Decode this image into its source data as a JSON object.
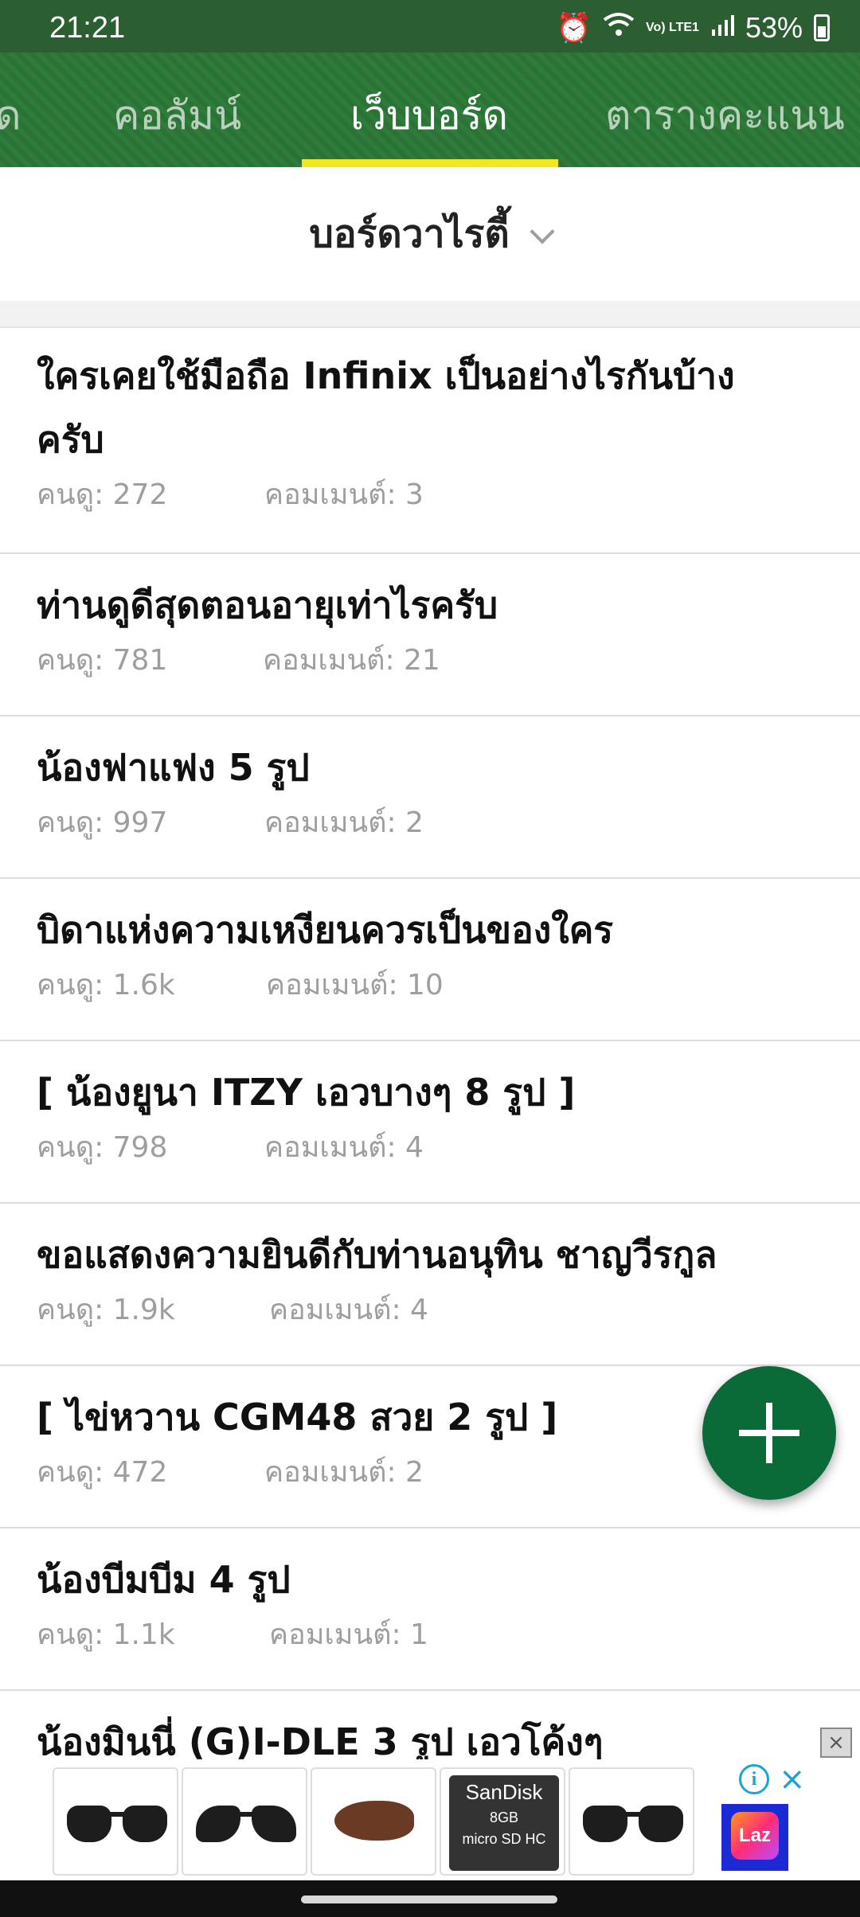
{
  "status_bar": {
    "time": "21:21",
    "battery": "53%",
    "network": "Vo) LTE1"
  },
  "tabs": [
    {
      "label": "ด",
      "active": false
    },
    {
      "label": "คอลัมน์",
      "active": false
    },
    {
      "label": "เว็บบอร์ด",
      "active": true
    },
    {
      "label": "ตารางคะแนน",
      "active": false
    }
  ],
  "board": {
    "title": "บอร์ดวาไรตี้"
  },
  "posts": [
    {
      "title_line1": "ใครเคยใช้มือถือ Infinix เป็นอย่างไรกันบ้าง",
      "title_line2": "ครับ",
      "views": "คนดู: 272",
      "comments": "คอมเมนต์: 3"
    },
    {
      "title": "ท่านดูดีสุดตอนอายุเท่าไรครับ",
      "views": "คนดู: 781",
      "comments": "คอมเมนต์: 21"
    },
    {
      "title": "น้องฟาแฟง 5 รูป",
      "views": "คนดู: 997",
      "comments": "คอมเมนต์: 2"
    },
    {
      "title": "บิดาแห่งความเหงียนควรเป็นของใคร",
      "views": "คนดู: 1.6k",
      "comments": "คอมเมนต์: 10"
    },
    {
      "title": "[ น้องยูนา  ITZY เอวบางๆ 8 รูป ]",
      "views": "คนดู: 798",
      "comments": "คอมเมนต์: 4"
    },
    {
      "title": "ขอแสดงความยินดีกับท่านอนุทิน ชาญวีรกูล",
      "views": "คนดู: 1.9k",
      "comments": "คอมเมนต์: 4"
    },
    {
      "title": "[ ไข่หวาน CGM48 สวย 2 รูป ]",
      "views": "คนดู: 472",
      "comments": "คอมเมนต์: 2"
    },
    {
      "title": "น้องบีมบีม 4 รูป",
      "views": "คนดู: 1.1k",
      "comments": "คอมเมนต์: 1"
    },
    {
      "title": "น้องมินนี่ (G)I-DLE 3 รูป เอวโค้งๆ"
    }
  ],
  "ad": {
    "sd_brand": "SanDisk",
    "sd_capacity": "8GB",
    "sd_type": "micro SD HC",
    "laz_logo": "Laz",
    "info_icon": "i",
    "close_icon": "×"
  },
  "colors": {
    "accent_green": "#0b6b38",
    "tab_underline": "#f3e81d",
    "header_green": "#2e7b3a"
  }
}
